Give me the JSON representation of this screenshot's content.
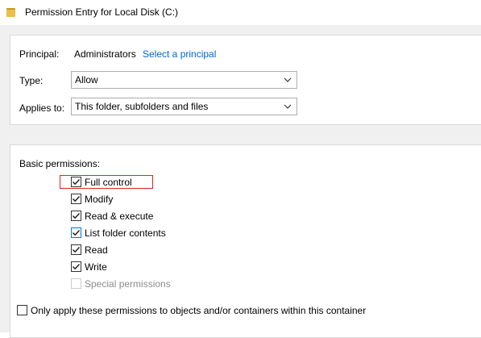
{
  "window": {
    "title": "Permission Entry for Local Disk (C:)"
  },
  "principal": {
    "label": "Principal:",
    "value": "Administrators",
    "link": "Select a principal"
  },
  "type": {
    "label": "Type:",
    "selected": "Allow"
  },
  "applies_to": {
    "label": "Applies to:",
    "selected": "This folder, subfolders and files"
  },
  "basic_permissions": {
    "heading": "Basic permissions:",
    "items": [
      {
        "label": "Full control",
        "checked": true
      },
      {
        "label": "Modify",
        "checked": true
      },
      {
        "label": "Read & execute",
        "checked": true
      },
      {
        "label": "List folder contents",
        "checked": true
      },
      {
        "label": "Read",
        "checked": true
      },
      {
        "label": "Write",
        "checked": true
      },
      {
        "label": "Special permissions",
        "checked": false,
        "disabled": true
      }
    ]
  },
  "apply_only": {
    "label": "Only apply these permissions to objects and/or containers within this container",
    "checked": false
  },
  "colors": {
    "accent": "#0078d7",
    "link": "#0066cc",
    "highlight": "#e0241b",
    "disabled_text": "#8d8d8d"
  }
}
